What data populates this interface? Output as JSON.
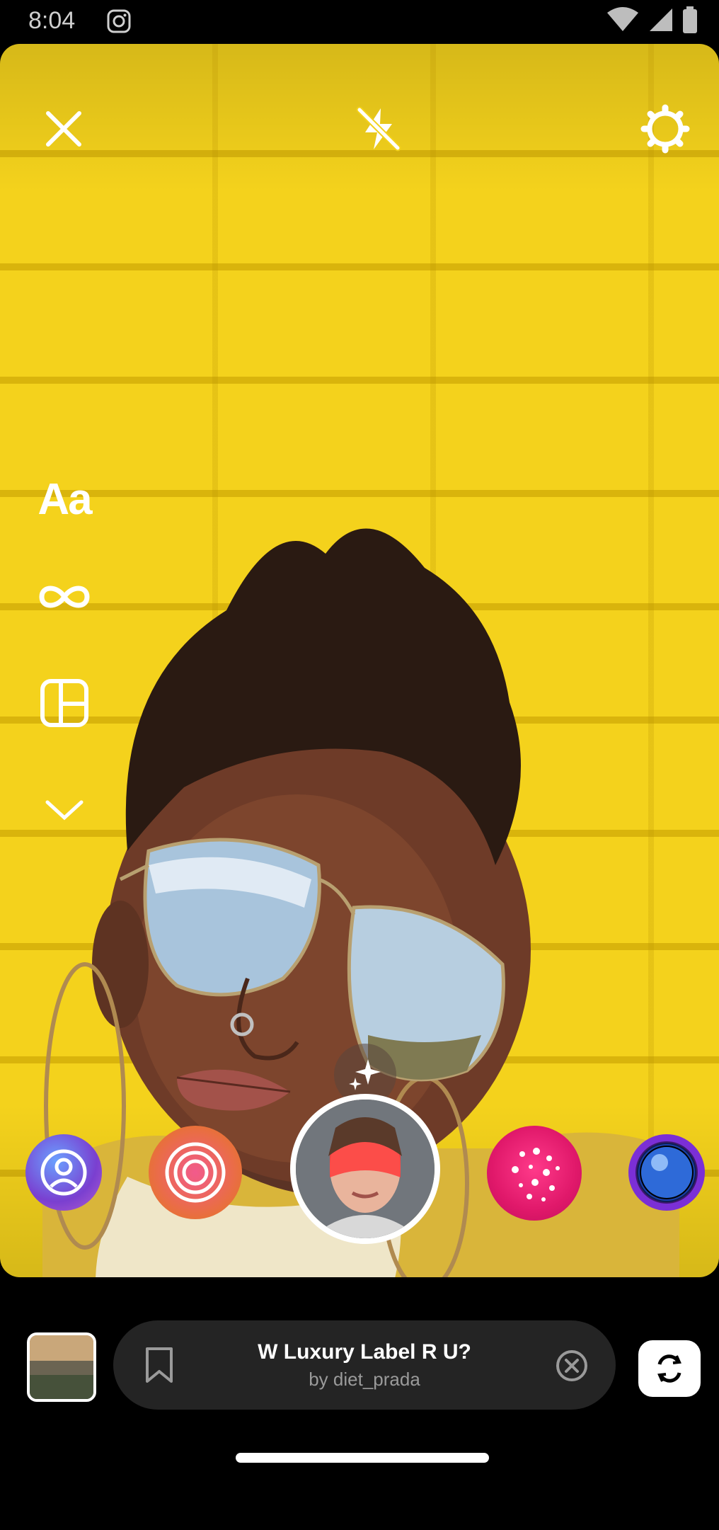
{
  "status_bar": {
    "time": "8:04"
  },
  "camera": {
    "tools": {
      "text_tool": "Aa"
    }
  },
  "effect": {
    "title": "W Luxury Label R U?",
    "author": "by diet_prada"
  },
  "colors": {
    "wall_yellow": "#f2d11c",
    "pill_bg": "#242424",
    "subtext": "#9a9a9a",
    "effect_pink": "#e0186a",
    "effect_purple": "#7b2fd6"
  },
  "icons": {
    "close": "close-icon",
    "flash": "flash-off-icon",
    "settings": "gear-icon",
    "boomerang": "infinity-icon",
    "layout": "layout-icon",
    "more": "chevron-down-icon",
    "sparkle": "sparkle-icon",
    "bookmark": "bookmark-icon",
    "clear": "close-circle-icon",
    "flip": "flip-camera-icon"
  }
}
